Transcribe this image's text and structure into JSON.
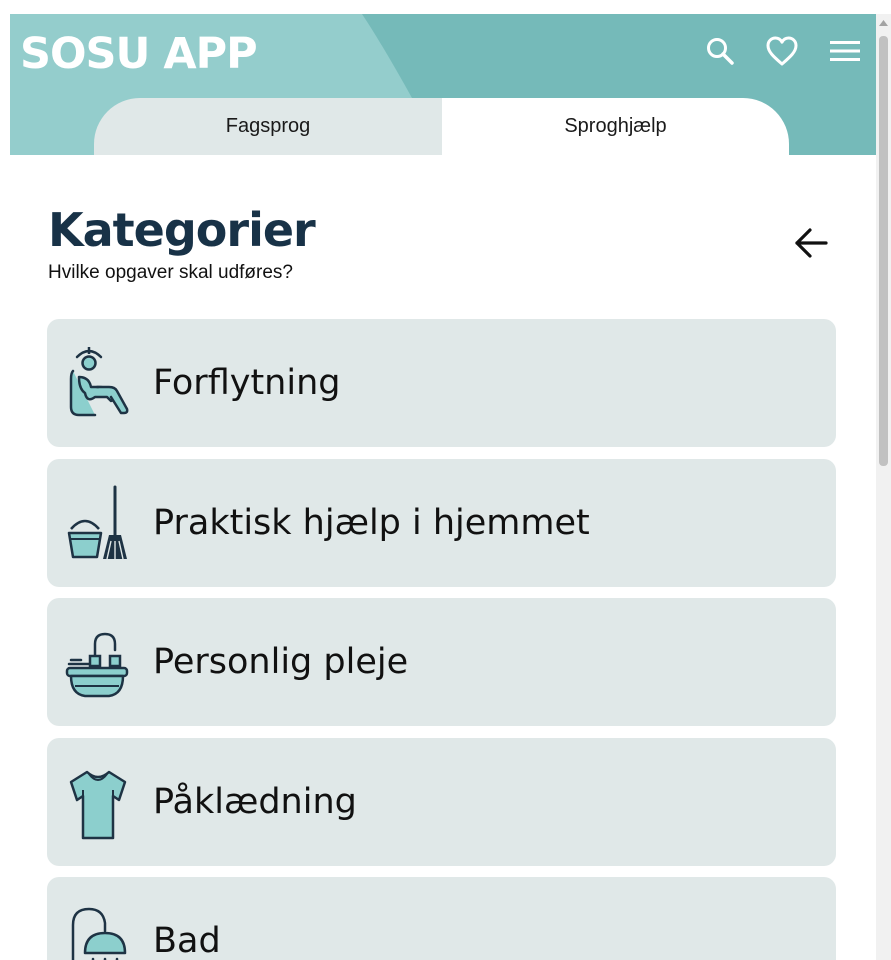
{
  "header": {
    "app_title": "SOSU APP",
    "icons": [
      "search-icon",
      "heart-icon",
      "menu-icon"
    ],
    "color_primary": "#75bab9",
    "color_light": "#94cdcc"
  },
  "tabs": [
    {
      "label": "Fagsprog",
      "active": false
    },
    {
      "label": "Sproghjælp",
      "active": true
    }
  ],
  "page": {
    "title": "Kategorier",
    "subtitle": "Hvilke opgaver skal udføres?",
    "back_icon": "arrow-left-icon",
    "title_color": "#183247"
  },
  "categories": [
    {
      "label": "Forflytning",
      "icon": "patient-lift-icon"
    },
    {
      "label": "Praktisk hjælp i hjemmet",
      "icon": "bucket-broom-icon"
    },
    {
      "label": "Personlig pleje",
      "icon": "sink-faucet-icon"
    },
    {
      "label": "Påklædning",
      "icon": "tshirt-icon"
    },
    {
      "label": "Bad",
      "icon": "shower-icon"
    }
  ],
  "colors": {
    "card_bg": "#e0e8e8",
    "icon_fill": "#8ccfcd",
    "icon_stroke": "#1e3344"
  }
}
